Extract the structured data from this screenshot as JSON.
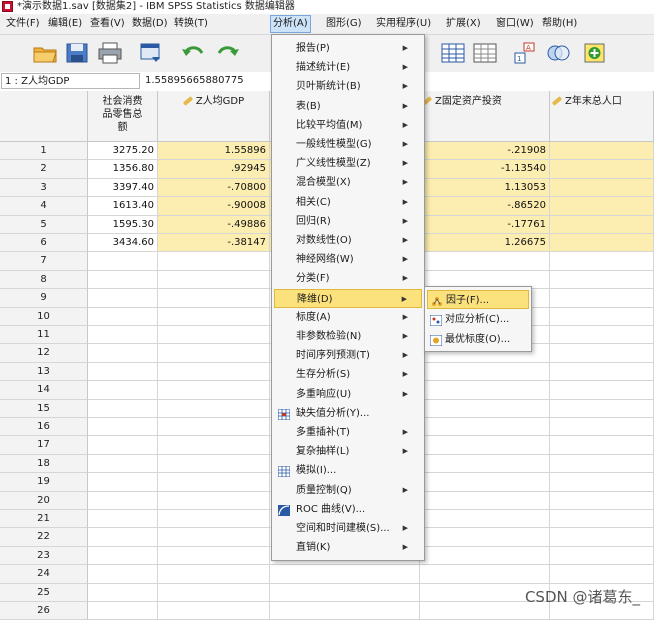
{
  "window": {
    "title": "*演示数据1.sav [数据集2] - IBM SPSS Statistics 数据编辑器"
  },
  "menubar": [
    {
      "label": "文件(F)",
      "x": 0
    },
    {
      "label": "编辑(E)",
      "x": 0
    },
    {
      "label": "查看(V)",
      "x": 0
    },
    {
      "label": "数据(D)",
      "x": 0
    },
    {
      "label": "转换(T)",
      "x": 0
    },
    {
      "label": "分析(A)",
      "x": 0
    },
    {
      "label": "图形(G)",
      "x": 0
    },
    {
      "label": "实用程序(U)",
      "x": 0
    },
    {
      "label": "扩展(X)",
      "x": 0
    },
    {
      "label": "窗口(W)",
      "x": 0
    },
    {
      "label": "帮助(H)",
      "x": 0
    }
  ],
  "active_menu": "分析(A)",
  "toolbar": {
    "icons": [
      "open-folder-icon",
      "save-icon",
      "print-icon",
      "dialog-recall-icon",
      "undo-icon",
      "redo-icon",
      "table-icon",
      "grid-icon",
      "value-labels-icon",
      "circles-icon",
      "add-icon"
    ]
  },
  "refbar": {
    "cell_ref": "1 : Z人均GDP",
    "cell_value": "1.55895665880775"
  },
  "grid": {
    "columns": [
      {
        "label": "社会消费品零售总额",
        "lines": [
          "社会消费",
          "品零售总",
          "额"
        ]
      },
      {
        "label": "Z人均GDP"
      },
      {
        "label": "Z固定资产投资"
      },
      {
        "label": "Z年末总人口"
      }
    ],
    "rows": [
      {
        "n": "1",
        "retail": "3275.20",
        "zgdp": "1.55896",
        "zinvest": "-.21908"
      },
      {
        "n": "2",
        "retail": "1356.80",
        "zgdp": ".92945",
        "zinvest": "-1.13540"
      },
      {
        "n": "3",
        "retail": "3397.40",
        "zgdp": "-.70800",
        "zinvest": "1.13053"
      },
      {
        "n": "4",
        "retail": "1613.40",
        "zgdp": "-.90008",
        "zinvest": "-.86520"
      },
      {
        "n": "5",
        "retail": "1595.30",
        "zgdp": "-.49886",
        "zinvest": "-.17761"
      },
      {
        "n": "6",
        "retail": "3434.60",
        "zgdp": "-.38147",
        "zinvest": "1.26675"
      }
    ],
    "empty_row_numbers": [
      "7",
      "8",
      "9",
      "10",
      "11",
      "12",
      "13",
      "14",
      "15",
      "16",
      "17",
      "18",
      "19",
      "20",
      "21",
      "22",
      "23",
      "24",
      "25",
      "26"
    ]
  },
  "analyze_menu": [
    {
      "label": "报告(P)",
      "submenu": true
    },
    {
      "label": "描述统计(E)",
      "submenu": true
    },
    {
      "label": "贝叶斯统计(B)",
      "submenu": true
    },
    {
      "label": "表(B)",
      "submenu": true
    },
    {
      "label": "比较平均值(M)",
      "submenu": true
    },
    {
      "label": "一般线性模型(G)",
      "submenu": true
    },
    {
      "label": "广义线性模型(Z)",
      "submenu": true
    },
    {
      "label": "混合模型(X)",
      "submenu": true
    },
    {
      "label": "相关(C)",
      "submenu": true
    },
    {
      "label": "回归(R)",
      "submenu": true
    },
    {
      "label": "对数线性(O)",
      "submenu": true
    },
    {
      "label": "神经网络(W)",
      "submenu": true
    },
    {
      "label": "分类(F)",
      "submenu": true
    },
    {
      "label": "降维(D)",
      "submenu": true,
      "selected": true
    },
    {
      "label": "标度(A)",
      "submenu": true
    },
    {
      "label": "非参数检验(N)",
      "submenu": true
    },
    {
      "label": "时间序列预测(T)",
      "submenu": true
    },
    {
      "label": "生存分析(S)",
      "submenu": true
    },
    {
      "label": "多重响应(U)",
      "submenu": true
    },
    {
      "label": "缺失值分析(Y)...",
      "submenu": false,
      "icon": "missing-values-icon"
    },
    {
      "label": "多重插补(T)",
      "submenu": true
    },
    {
      "label": "复杂抽样(L)",
      "submenu": true
    },
    {
      "label": "模拟(I)...",
      "submenu": false,
      "icon": "simulation-icon"
    },
    {
      "label": "质量控制(Q)",
      "submenu": true
    },
    {
      "label": "ROC 曲线(V)...",
      "submenu": false,
      "icon": "roc-curve-icon"
    },
    {
      "label": "空间和时间建模(S)...",
      "submenu": true
    },
    {
      "label": "直销(K)",
      "submenu": true
    }
  ],
  "dimension_submenu": [
    {
      "label": "因子(F)...",
      "icon": "factor-icon",
      "selected": true
    },
    {
      "label": "对应分析(C)...",
      "icon": "correspondence-icon"
    },
    {
      "label": "最优标度(O)...",
      "icon": "optimal-scaling-icon"
    }
  ],
  "watermark": "CSDN @诸葛东_",
  "colors": {
    "highlight": "#fcedb0",
    "menu_selected": "#fbe27d",
    "accent": "#c8102e"
  }
}
